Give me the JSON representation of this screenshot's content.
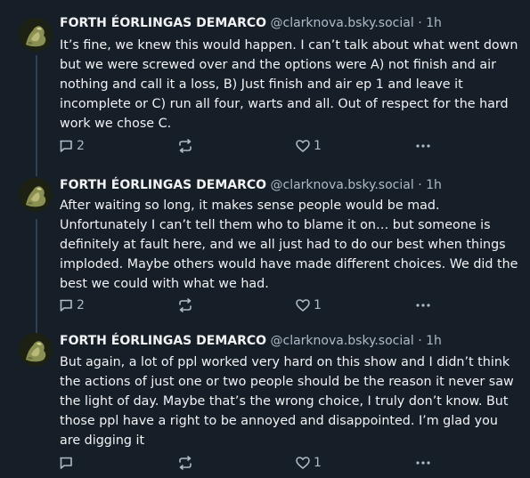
{
  "colors": {
    "background": "#161e27",
    "text_primary": "#f1f3f5",
    "text_secondary": "#aebbc9",
    "thread_line": "#2e4052"
  },
  "posts": [
    {
      "author_name": "FORTH ÉORLINGAS DEMARCO",
      "handle": "@clarknova.bsky.social",
      "separator": "·",
      "time": "1h",
      "text": "It’s fine, we knew this would happen. I can’t talk about what went down but we were screwed over and the options were A) not finish and air nothing and call it a loss, B) Just finish and air ep 1 and leave it incomplete or C) run all four, warts and all. Out of respect for the hard work we chose C.",
      "reply_count": "2",
      "repost_count": "",
      "like_count": "1",
      "icons": [
        "reply-icon",
        "repost-icon",
        "heart-icon",
        "more-icon"
      ]
    },
    {
      "author_name": "FORTH ÉORLINGAS DEMARCO",
      "handle": "@clarknova.bsky.social",
      "separator": "·",
      "time": "1h",
      "text": "After waiting so long, it makes sense people would be mad. Unfortunately I can’t tell them who to blame it on… but someone is definitely at fault here, and we all just had to do our best when things imploded. Maybe others would have made different choices. We did the best we could with what we had.",
      "reply_count": "2",
      "repost_count": "",
      "like_count": "1",
      "icons": [
        "reply-icon",
        "repost-icon",
        "heart-icon",
        "more-icon"
      ]
    },
    {
      "author_name": "FORTH ÉORLINGAS DEMARCO",
      "handle": "@clarknova.bsky.social",
      "separator": "·",
      "time": "1h",
      "text": "But again, a lot of ppl worked very hard on this show and I didn’t think the actions of just one or two people should be the reason it never saw the light of day. Maybe that’s the wrong choice, I truly don’t know. But those ppl have a right to be annoyed and disappointed. I’m glad you are digging it",
      "reply_count": "",
      "repost_count": "",
      "like_count": "1",
      "icons": [
        "reply-icon",
        "repost-icon",
        "heart-icon",
        "more-icon"
      ]
    }
  ]
}
